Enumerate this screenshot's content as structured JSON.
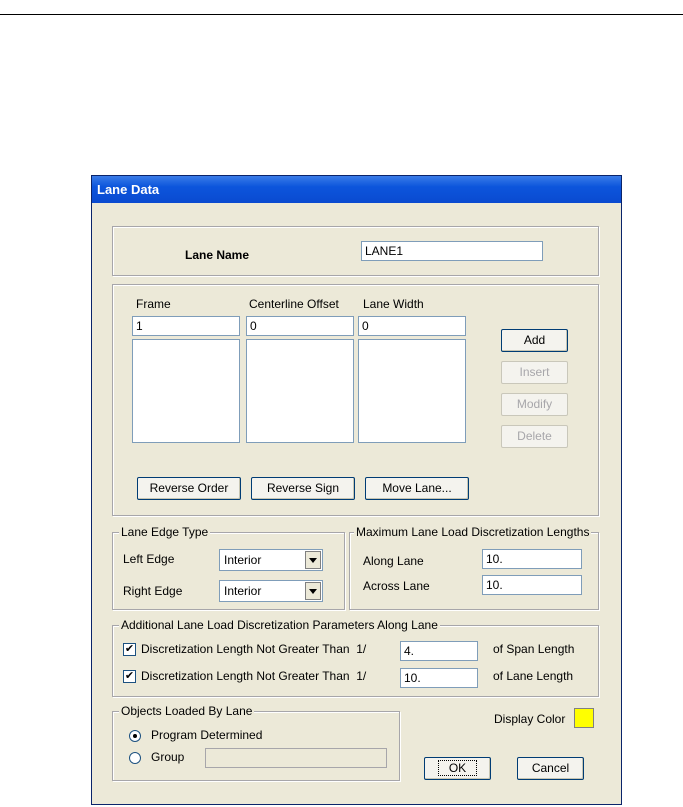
{
  "dialog": {
    "title": "Lane Data"
  },
  "lane_name": {
    "label": "Lane Name",
    "value": "LANE1"
  },
  "columns": {
    "frame": {
      "header": "Frame",
      "value": "1"
    },
    "offset": {
      "header": "Centerline Offset",
      "value": "0"
    },
    "width": {
      "header": "Lane Width",
      "value": "0"
    }
  },
  "list_buttons": {
    "add": "Add",
    "insert": "Insert",
    "modify": "Modify",
    "delete": "Delete"
  },
  "order_buttons": {
    "reverse_order": "Reverse Order",
    "reverse_sign": "Reverse Sign",
    "move_lane": "Move Lane..."
  },
  "edge_type": {
    "legend": "Lane Edge Type",
    "left_label": "Left Edge",
    "left_value": "Interior",
    "right_label": "Right Edge",
    "right_value": "Interior"
  },
  "max_disc": {
    "legend": "Maximum Lane Load Discretization Lengths",
    "along_label": "Along Lane",
    "along_value": "10.",
    "across_label": "Across Lane",
    "across_value": "10."
  },
  "additional": {
    "legend": "Additional Lane Load Discretization Parameters Along Lane",
    "row1_label": "Discretization Length Not Greater Than  1/",
    "row1_value": "4.",
    "row1_suffix": "of Span Length",
    "row1_checked": true,
    "row2_label": "Discretization Length Not Greater Than  1/",
    "row2_value": "10.",
    "row2_suffix": "of Lane Length",
    "row2_checked": true
  },
  "objects": {
    "legend": "Objects Loaded By Lane",
    "option1": "Program Determined",
    "option2": "Group",
    "group_value": "",
    "selected": "Program Determined"
  },
  "display_color": {
    "label": "Display Color",
    "color": "#ffff00"
  },
  "footer": {
    "ok": "OK",
    "cancel": "Cancel"
  },
  "icons": {
    "checkmark": "✔"
  }
}
